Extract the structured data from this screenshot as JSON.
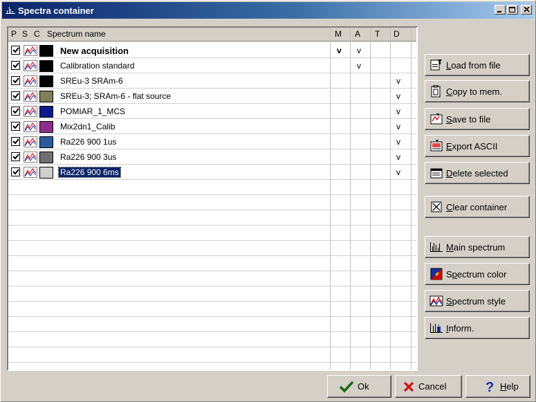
{
  "window": {
    "title": "Spectra container"
  },
  "columns": {
    "p": "P",
    "s": "S",
    "c": "C",
    "name": "Spectrum name",
    "m": "M",
    "a": "A",
    "t": "T",
    "d": "D"
  },
  "rows": [
    {
      "name": "New acquisition",
      "color": "#000000",
      "m": "v",
      "a": "v",
      "t": "",
      "d": ""
    },
    {
      "name": "Calibration standard",
      "color": "#000000",
      "m": "",
      "a": "v",
      "t": "",
      "d": ""
    },
    {
      "name": "SREu-3 SRAm-6",
      "color": "#000000",
      "m": "",
      "a": "",
      "t": "",
      "d": "v"
    },
    {
      "name": "SREu-3; SRAm-6 - flat source",
      "color": "#7f7f5a",
      "m": "",
      "a": "",
      "t": "",
      "d": "v"
    },
    {
      "name": "POMIAR_1_MCS",
      "color": "#0c1a8a",
      "m": "",
      "a": "",
      "t": "",
      "d": "v"
    },
    {
      "name": "Mix2dn1_Calib",
      "color": "#8a2f8a",
      "m": "",
      "a": "",
      "t": "",
      "d": "v"
    },
    {
      "name": "Ra226 900 1us",
      "color": "#2a5a9a",
      "m": "",
      "a": "",
      "t": "",
      "d": "v"
    },
    {
      "name": "Ra226 900 3us",
      "color": "#707070",
      "m": "",
      "a": "",
      "t": "",
      "d": "v"
    },
    {
      "name": "Ra226 900 6ms",
      "color": "#cfcfcf",
      "m": "",
      "a": "",
      "t": "",
      "d": "v"
    }
  ],
  "side_buttons": {
    "load": {
      "mn": "L",
      "rest": "oad from file"
    },
    "copy": {
      "mn": "C",
      "rest": "opy to mem."
    },
    "save": {
      "mn": "S",
      "rest": "ave to file"
    },
    "export": {
      "mn": "E",
      "rest": "xport ASCII"
    },
    "delete": {
      "mn": "D",
      "rest": "elete selected"
    },
    "clear": {
      "mn": "C",
      "rest": "lear container"
    },
    "main": {
      "mn": "M",
      "rest": "ain spectrum"
    },
    "color": {
      "pre": "S",
      "mn": "p",
      "rest": "ectrum color"
    },
    "style": {
      "mn": "S",
      "rest": "pectrum style"
    },
    "inform": {
      "mn": "I",
      "rest": "nform."
    }
  },
  "bottom_buttons": {
    "ok": "Ok",
    "cancel": "Cancel",
    "help": {
      "mn": "H",
      "rest": "elp"
    }
  }
}
